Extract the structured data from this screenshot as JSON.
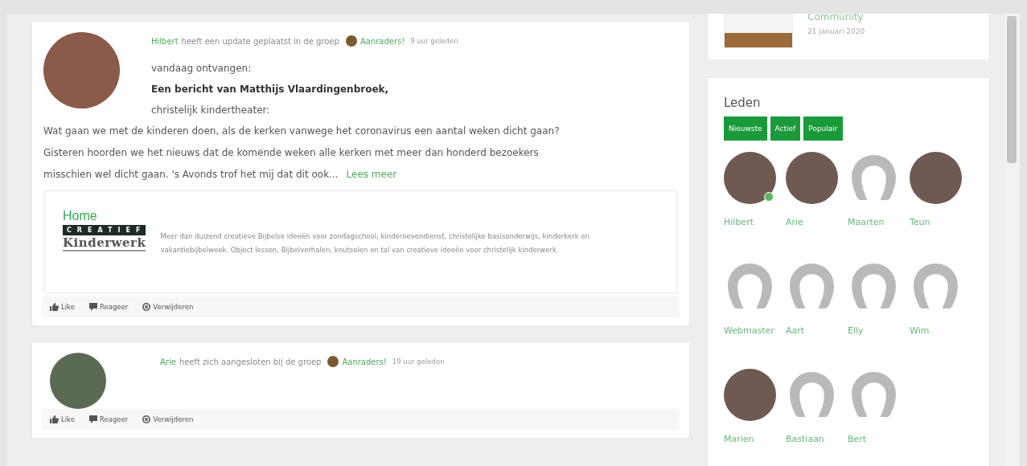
{
  "posts": [
    {
      "actor": "Hilbert",
      "action": "heeft een update geplaatst in de groep",
      "group": "Aanraders!",
      "time": "9 uur geleden",
      "lines": [
        {
          "kind": "plain",
          "text": "vandaag ontvangen:"
        },
        {
          "kind": "bold",
          "text": "Een bericht van Matthijs Vlaardingenbroek,"
        },
        {
          "kind": "plain",
          "text": "christelijk kindertheater:"
        }
      ],
      "excerpt": [
        "Wat gaan we met de kinderen doen, als de kerken vanwege het coronavirus een aantal weken dicht gaan?",
        "Gisteren hoorden we het nieuws dat de komende weken alle kerken met meer dan honderd bezoekers",
        "misschien wel dicht gaan. 's Avonds trof het mij dat dit ook..."
      ],
      "read_more": "Lees meer",
      "preview": {
        "title": "Home",
        "logo_top": "CREATIEF",
        "logo_bottom": "Kinderwerk",
        "description": "Meer dan duizend creatieve Bijbelse ideeën voor zondagschool, kindernevendienst, christelijke basisonderwijs, kinderkerk en vakantiebijbelweek. Object lessen, Bijbelverhalen, knutselen en tal van creatieve ideeën voor christelijk kinderwerk."
      },
      "actions": [
        {
          "kind": "like",
          "label": "Like"
        },
        {
          "kind": "comment",
          "label": "Reageer"
        },
        {
          "kind": "delete",
          "label": "Verwijderen"
        }
      ]
    },
    {
      "actor": "Arie",
      "action": "heeft zich aangesloten bij de groep",
      "group": "Aanraders!",
      "time": "19 uur geleden",
      "actions": [
        {
          "kind": "like",
          "label": "Like"
        },
        {
          "kind": "comment",
          "label": "Reageer"
        },
        {
          "kind": "delete",
          "label": "Verwijderen"
        }
      ]
    }
  ],
  "sidebar": {
    "article": {
      "title": "Community",
      "date": "21 januari 2020"
    },
    "members": {
      "title": "Leden",
      "filters": [
        {
          "label": "Nieuwste",
          "selected": true
        },
        {
          "label": "Actief",
          "selected": true
        },
        {
          "label": "Populair",
          "selected": true
        }
      ],
      "items": [
        {
          "name": "Hilbert",
          "has_photo": true,
          "online": true
        },
        {
          "name": "Arie",
          "has_photo": true,
          "online": false
        },
        {
          "name": "Maarten",
          "has_photo": false,
          "online": false
        },
        {
          "name": "Teun",
          "has_photo": true,
          "online": false
        },
        {
          "name": "Webmaster",
          "has_photo": false,
          "online": false
        },
        {
          "name": "Aart",
          "has_photo": false,
          "online": false
        },
        {
          "name": "Elly",
          "has_photo": false,
          "online": false
        },
        {
          "name": "Wim",
          "has_photo": false,
          "online": false
        },
        {
          "name": "Marien",
          "has_photo": true,
          "online": false
        },
        {
          "name": "Bastiaan",
          "has_photo": false,
          "online": false
        },
        {
          "name": "Bert",
          "has_photo": false,
          "online": false
        }
      ]
    }
  }
}
